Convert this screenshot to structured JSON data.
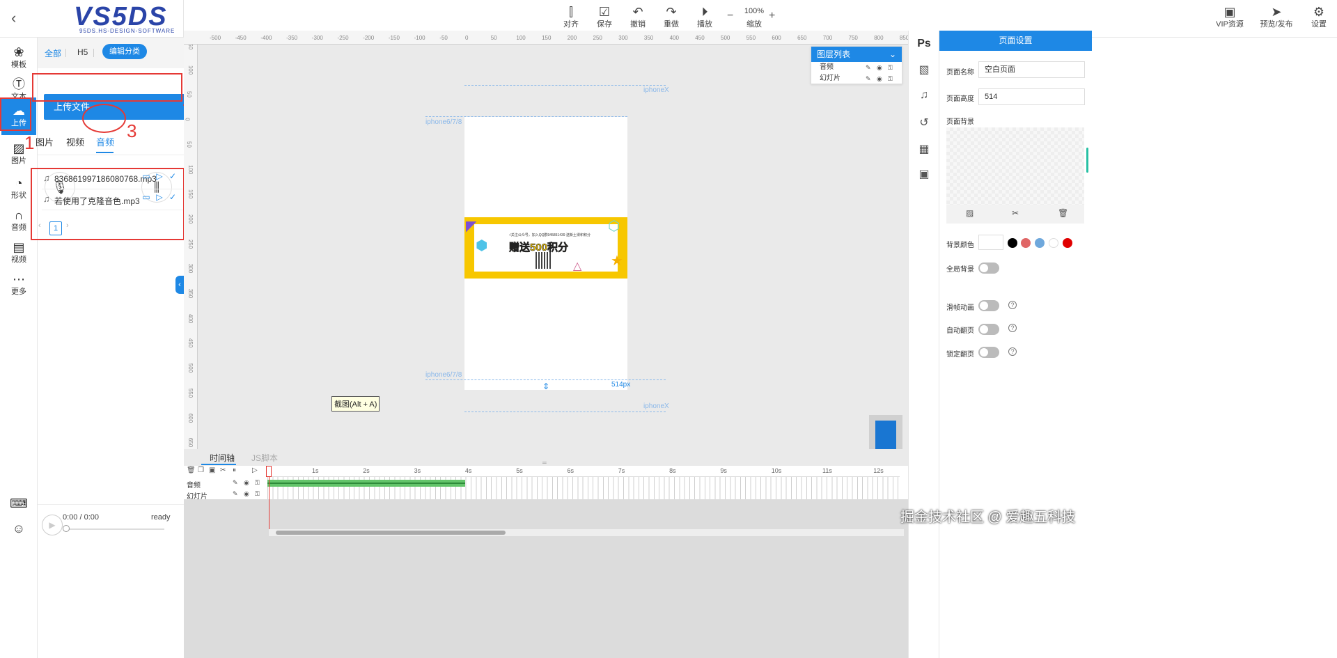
{
  "app": {
    "logo_text": "VS5DS",
    "logo_subtitle": "95DS.HS-DESIGN-SOFTWARE"
  },
  "toolbar": {
    "items": [
      {
        "label": "对齐",
        "icon": "align-icon"
      },
      {
        "label": "保存",
        "icon": "save-icon"
      },
      {
        "label": "撤销",
        "icon": "undo-icon"
      },
      {
        "label": "重做",
        "icon": "redo-icon"
      },
      {
        "label": "播放",
        "icon": "play-icon"
      }
    ],
    "zoom_value": "100%",
    "zoom_label": "缩放",
    "right_items": [
      {
        "label": "VIP资源",
        "icon": "vip-icon"
      },
      {
        "label": "预览/发布",
        "icon": "send-icon"
      },
      {
        "label": "设置",
        "icon": "gear-icon"
      }
    ]
  },
  "rail": {
    "items": [
      {
        "label": "模板",
        "icon": "template-icon"
      },
      {
        "label": "文本",
        "icon": "text-icon"
      },
      {
        "label": "上传",
        "icon": "upload-icon",
        "active": true
      },
      {
        "label": "图片",
        "icon": "image-icon"
      },
      {
        "label": "形状",
        "icon": "shape-icon"
      },
      {
        "label": "音频",
        "icon": "headphones-icon"
      },
      {
        "label": "视频",
        "icon": "video-icon"
      },
      {
        "label": "更多",
        "icon": "more-icon"
      }
    ]
  },
  "upload_panel": {
    "categories": {
      "all": "全部",
      "h5": "H5",
      "edit": "编辑分类"
    },
    "upload_button": "上传文件",
    "media_tabs": [
      "图片",
      "视频",
      "音频"
    ],
    "active_media_tab": "音频",
    "files": [
      {
        "name": "836861997186080768.mp3"
      },
      {
        "name": "若使用了克隆音色.mp3"
      }
    ],
    "pager": {
      "prev": "‹",
      "current": "1",
      "next": "›"
    },
    "player": {
      "time": "0:00 / 0:00",
      "status": "ready"
    }
  },
  "annotations": {
    "n1": "1",
    "n2": "2",
    "n3": "3",
    "n4": "4"
  },
  "canvas": {
    "ruler_h": [
      "-500",
      "-450",
      "-400",
      "-350",
      "-300",
      "-250",
      "-200",
      "-150",
      "-100",
      "-50",
      "0",
      "50",
      "100",
      "150",
      "200",
      "250",
      "300",
      "350",
      "400",
      "450",
      "500",
      "550",
      "600",
      "650",
      "700",
      "750",
      "800",
      "850"
    ],
    "ruler_v": [
      "150",
      "100",
      "50",
      "0",
      "50",
      "100",
      "150",
      "200",
      "250",
      "300",
      "350",
      "400",
      "450",
      "500",
      "550",
      "600",
      "650"
    ],
    "guides": {
      "top": "iphoneX",
      "mid": "iphone6/7/8",
      "low": "iphone6/7/8",
      "bot": "iphoneX"
    },
    "page_height_label": "514px",
    "banner": {
      "small_text": "√关注公众号，加入QQ群945851439 送新土得积积分",
      "big_text": "赠送500积分"
    },
    "tooltip": "截图(Alt + A)",
    "layer_panel": {
      "title": "图层列表",
      "rows": [
        "音频",
        "幻灯片"
      ]
    }
  },
  "timeline": {
    "tabs": [
      "时间轴",
      "JS脚本"
    ],
    "tracks": [
      "音频",
      "幻灯片"
    ],
    "seconds": [
      "1s",
      "2s",
      "3s",
      "4s",
      "5s",
      "6s",
      "7s",
      "8s",
      "9s",
      "10s",
      "11s",
      "12s"
    ],
    "audio_clip_end_s": 4
  },
  "settings": {
    "title": "页面设置",
    "page_name_label": "页面名称",
    "page_name": "空白页面",
    "page_height_label": "页面高度",
    "page_height": "514",
    "page_bg_label": "页面背景",
    "bg_color_label": "背景颜色",
    "colors": [
      "#000000",
      "#e06666",
      "#6fa8dc",
      "#ffffff",
      "#e00000"
    ],
    "global_bg_label": "全局背景",
    "slide_anim_label": "滑帧动画",
    "auto_flip_label": "自动翻页",
    "lock_flip_label": "锁定翻页"
  },
  "right_strip": [
    "ps-icon",
    "pattern-icon",
    "music-icon",
    "history-icon",
    "grid-icon",
    "image-frame-icon"
  ],
  "right_strip_ps": "Ps",
  "watermark": "掘金技术社区 @ 爱趣五科技"
}
